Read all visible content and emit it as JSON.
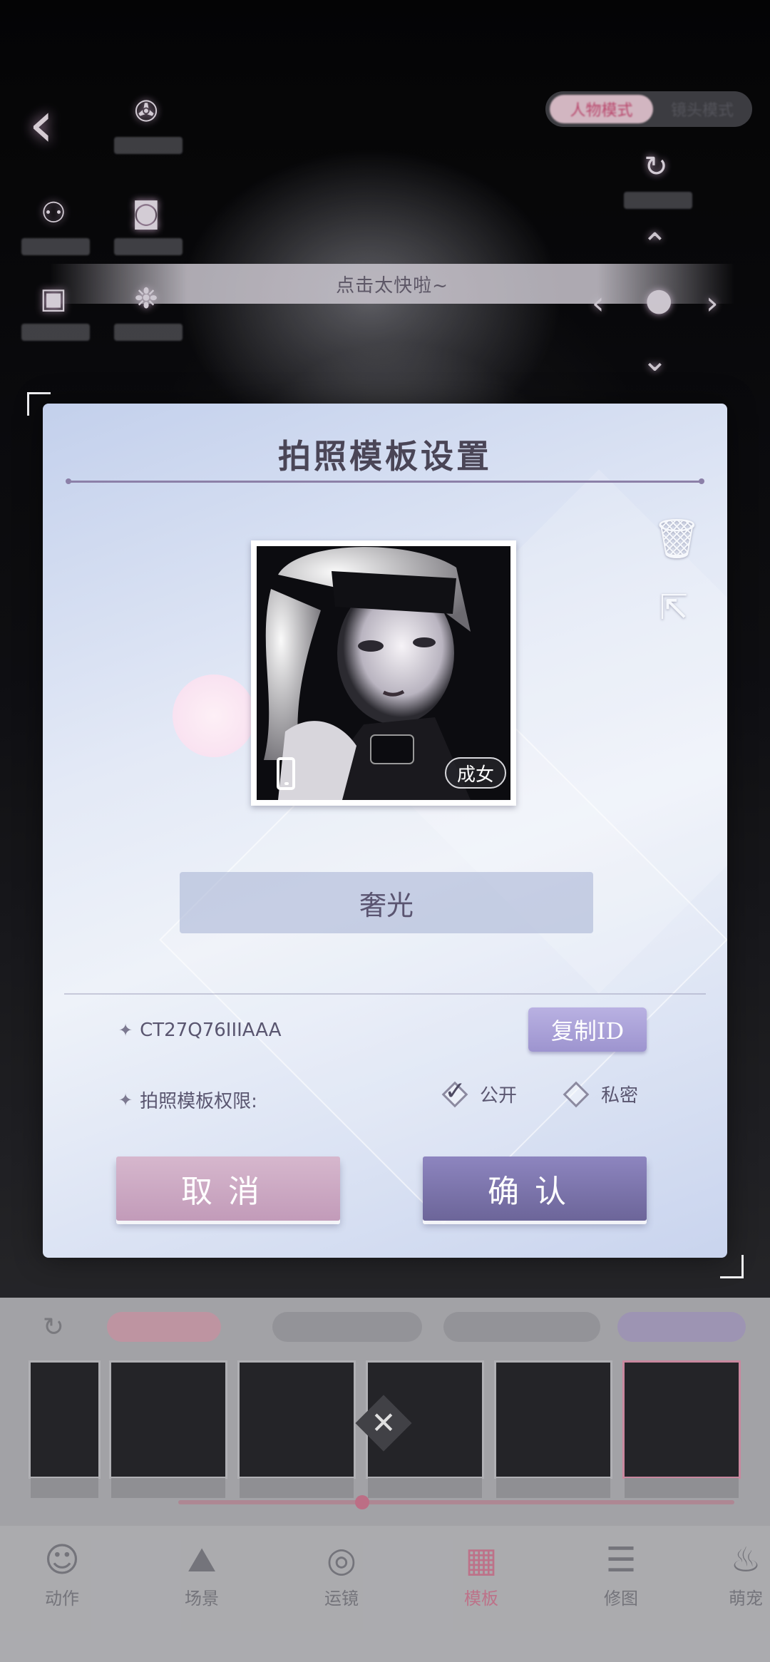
{
  "toast": "点击太快啦~",
  "mode_toggle": {
    "on_label": "人物模式",
    "off_label": "镜头模式"
  },
  "dialog": {
    "title": "拍照模板设置",
    "photo_tag": "成女",
    "name_value": "奢光",
    "template_id": "CT27Q76IIIAAA",
    "copy_label": "复制ID",
    "permission_label": "拍照模板权限:",
    "permission_options": [
      "公开",
      "私密"
    ],
    "permission_selected": "公开",
    "cancel_label": "取消",
    "confirm_label": "确认"
  },
  "nav": [
    "动作",
    "场景",
    "运镜",
    "模板",
    "修图",
    "萌宠"
  ],
  "nav_active": "模板",
  "colors": {
    "accent": "#8d85bf",
    "cancel": "#c29bb9",
    "active_nav": "#d8829c"
  }
}
